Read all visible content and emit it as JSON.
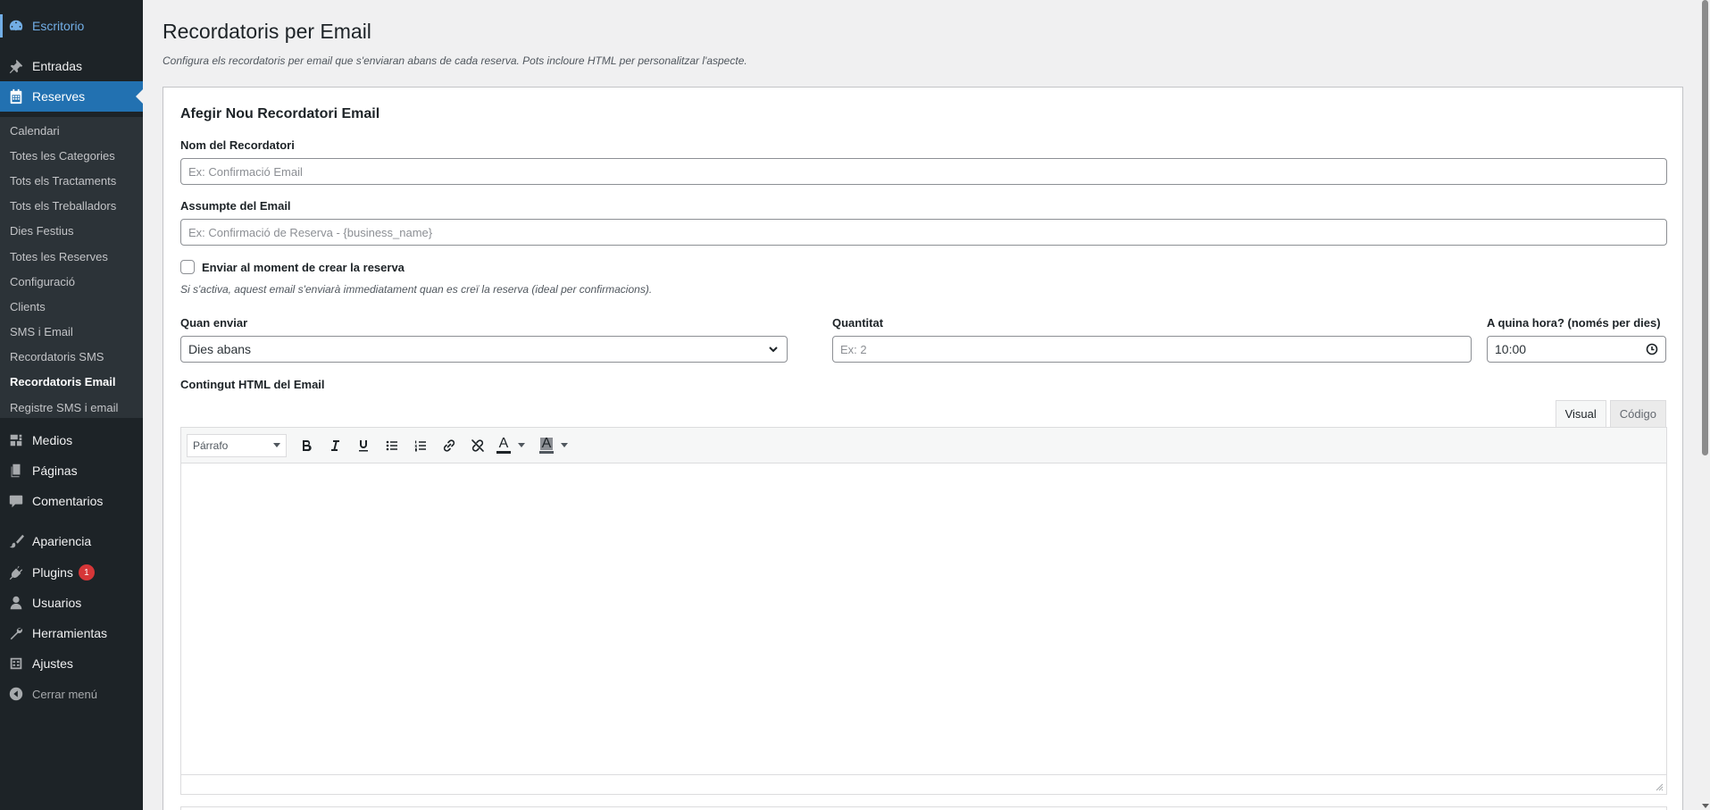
{
  "sidebar": {
    "dashboard": "Escritorio",
    "posts": "Entradas",
    "reserves": "Reserves",
    "submenu": [
      "Calendari",
      "Totes les Categories",
      "Tots els Tractaments",
      "Tots els Treballadors",
      "Dies Festius",
      "Totes les Reserves",
      "Configuració",
      "Clients",
      "SMS i Email",
      "Recordatoris SMS",
      "Recordatoris Email",
      "Registre SMS i email"
    ],
    "active_submenu": "Recordatoris Email",
    "media": "Medios",
    "pages": "Páginas",
    "comments": "Comentarios",
    "appearance": "Apariencia",
    "plugins": "Plugins",
    "plugins_badge": "1",
    "users": "Usuarios",
    "tools": "Herramientas",
    "settings": "Ajustes",
    "collapse": "Cerrar menú"
  },
  "page": {
    "title": "Recordatoris per Email",
    "description": "Configura els recordatoris per email que s'enviaran abans de cada reserva. Pots incloure HTML per personalitzar l'aspecte."
  },
  "form": {
    "card_title": "Afegir Nou Recordatori Email",
    "name_label": "Nom del Recordatori",
    "name_placeholder": "Ex: Confirmació Email",
    "subject_label": "Assumpte del Email",
    "subject_placeholder": "Ex: Confirmació de Reserva - {business_name}",
    "send_on_create_label": "Enviar al moment de crear la reserva",
    "send_on_create_checked": false,
    "send_on_create_hint": "Si s'activa, aquest email s'enviarà immediatament quan es creï la reserva (ideal per confirmacions).",
    "when_label": "Quan enviar",
    "when_value": "Dies abans",
    "quantity_label": "Quantitat",
    "quantity_placeholder": "Ex: 2",
    "time_label": "A quina hora? (només per dies)",
    "time_value": "10:00",
    "content_label": "Contingut HTML del Email"
  },
  "editor": {
    "tab_visual": "Visual",
    "tab_code": "Código",
    "format_select": "Párrafo",
    "text_color_letter": "A",
    "bg_color_letter": "A"
  },
  "colors": {
    "sidebar_bg": "#1d2327",
    "submenu_bg": "#2c3338",
    "accent": "#2271b1",
    "badge": "#d63638"
  }
}
